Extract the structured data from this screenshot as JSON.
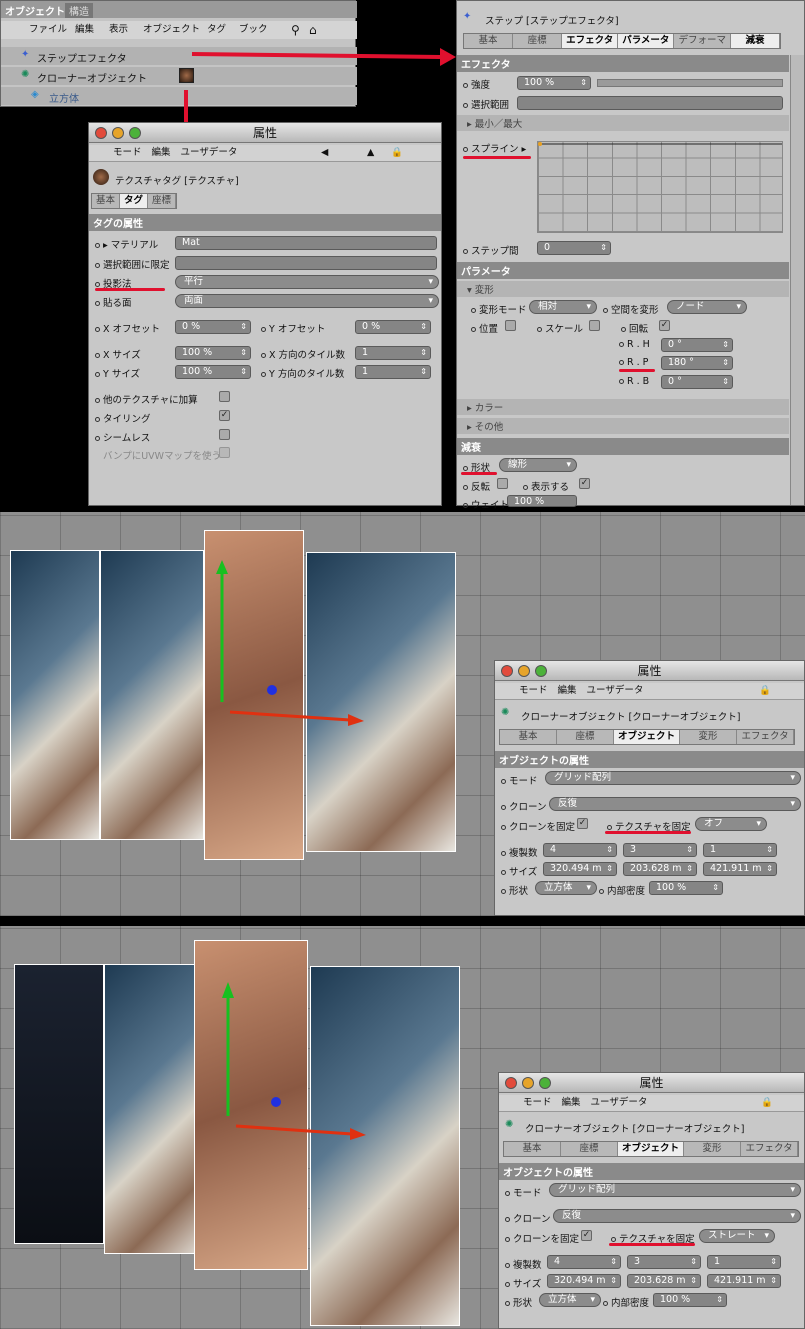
{
  "objmgr": {
    "tab1": "オブジェクト",
    "tab2": "構造",
    "menu": [
      "ファイル",
      "編集",
      "表示",
      "オブジェクト",
      "タグ",
      "ブック"
    ],
    "items": [
      "ステップエフェクタ",
      "クローナーオブジェクト",
      "立方体"
    ]
  },
  "tagattr": {
    "title": "属性",
    "toolbar": [
      "モード",
      "編集",
      "ユーザデータ"
    ],
    "name": "テクスチャタグ [テクスチャ]",
    "tabs": [
      "基本",
      "タグ",
      "座標"
    ],
    "section": "タグの属性",
    "material_label": "マテリアル",
    "material_value": "Mat",
    "restrict_label": "選択範囲に限定",
    "projection_label": "投影法",
    "projection_value": "平行",
    "side_label": "貼る面",
    "side_value": "両面",
    "xoff_label": "X オフセット",
    "xoff_value": "0 %",
    "yoff_label": "Y オフセット",
    "yoff_value": "0 %",
    "xsize_label": "X サイズ",
    "xsize_value": "100 %",
    "xtile_label": "X 方向のタイル数",
    "xtile_value": "1",
    "ysize_label": "Y サイズ",
    "ysize_value": "100 %",
    "ytile_label": "Y 方向のタイル数",
    "ytile_value": "1",
    "add_label": "他のテクスチャに加算",
    "tiling_label": "タイリング",
    "seamless_label": "シームレス",
    "bump_label": "バンプにUVWマップを使う"
  },
  "stepattr": {
    "name": "ステップ [ステップエフェクタ]",
    "tabs": [
      "基本",
      "座標",
      "エフェクタ",
      "パラメータ",
      "デフォーマ",
      "減衰"
    ],
    "effector_header": "エフェクタ",
    "strength_label": "強度",
    "strength_value": "100 %",
    "selection_label": "選択範囲",
    "minmax": "最小／最大",
    "spline_label": "スプライン",
    "gap_label": "ステップ間",
    "gap_value": "0",
    "param_header": "パラメータ",
    "transform_sub": "変形",
    "tmode_label": "変形モード",
    "tmode_value": "相対",
    "tspace_label": "空間を変形",
    "tspace_value": "ノード",
    "pos_label": "位置",
    "scale_label": "スケール",
    "rot_label": "回転",
    "rh_label": "R . H",
    "rh_value": "0 °",
    "rp_label": "R . P",
    "rp_value": "180 °",
    "rb_label": "R . B",
    "rb_value": "0 °",
    "color_sub": "カラー",
    "other_sub": "その他",
    "falloff_header": "減衰",
    "shape_label": "形状",
    "shape_value": "線形",
    "invert_label": "反転",
    "visible_label": "表示する",
    "weight_label": "ウェイト",
    "weight_value": "100 %"
  },
  "cloner1": {
    "title": "属性",
    "toolbar": [
      "モード",
      "編集",
      "ユーザデータ"
    ],
    "name": "クローナーオブジェクト [クローナーオブジェクト]",
    "tabs": [
      "基本",
      "座標",
      "オブジェクト",
      "変形",
      "エフェクタ"
    ],
    "section": "オブジェクトの属性",
    "mode_label": "モード",
    "mode_value": "グリッド配列",
    "clone_label": "クローン",
    "clone_value": "反復",
    "fix_label": "クローンを固定",
    "texfix_label": "テクスチャを固定",
    "texfix_value": "オフ",
    "count_label": "複製数",
    "count": [
      "4",
      "3",
      "1"
    ],
    "size_label": "サイズ",
    "size": [
      "320.494 m",
      "203.628 m",
      "421.911 m"
    ],
    "shape_label": "形状",
    "shape_value": "立方体",
    "density_label": "内部密度",
    "density_value": "100 %"
  },
  "cloner2": {
    "title": "属性",
    "toolbar": [
      "モード",
      "編集",
      "ユーザデータ"
    ],
    "name": "クローナーオブジェクト [クローナーオブジェクト]",
    "tabs": [
      "基本",
      "座標",
      "オブジェクト",
      "変形",
      "エフェクタ"
    ],
    "section": "オブジェクトの属性",
    "mode_label": "モード",
    "mode_value": "グリッド配列",
    "clone_label": "クローン",
    "clone_value": "反復",
    "fix_label": "クローンを固定",
    "texfix_label": "テクスチャを固定",
    "texfix_value": "ストレート",
    "count_label": "複製数",
    "count": [
      "4",
      "3",
      "1"
    ],
    "size_label": "サイズ",
    "size": [
      "320.494 m",
      "203.628 m",
      "421.911 m"
    ],
    "shape_label": "形状",
    "shape_value": "立方体",
    "density_label": "内部密度",
    "density_value": "100 %"
  }
}
